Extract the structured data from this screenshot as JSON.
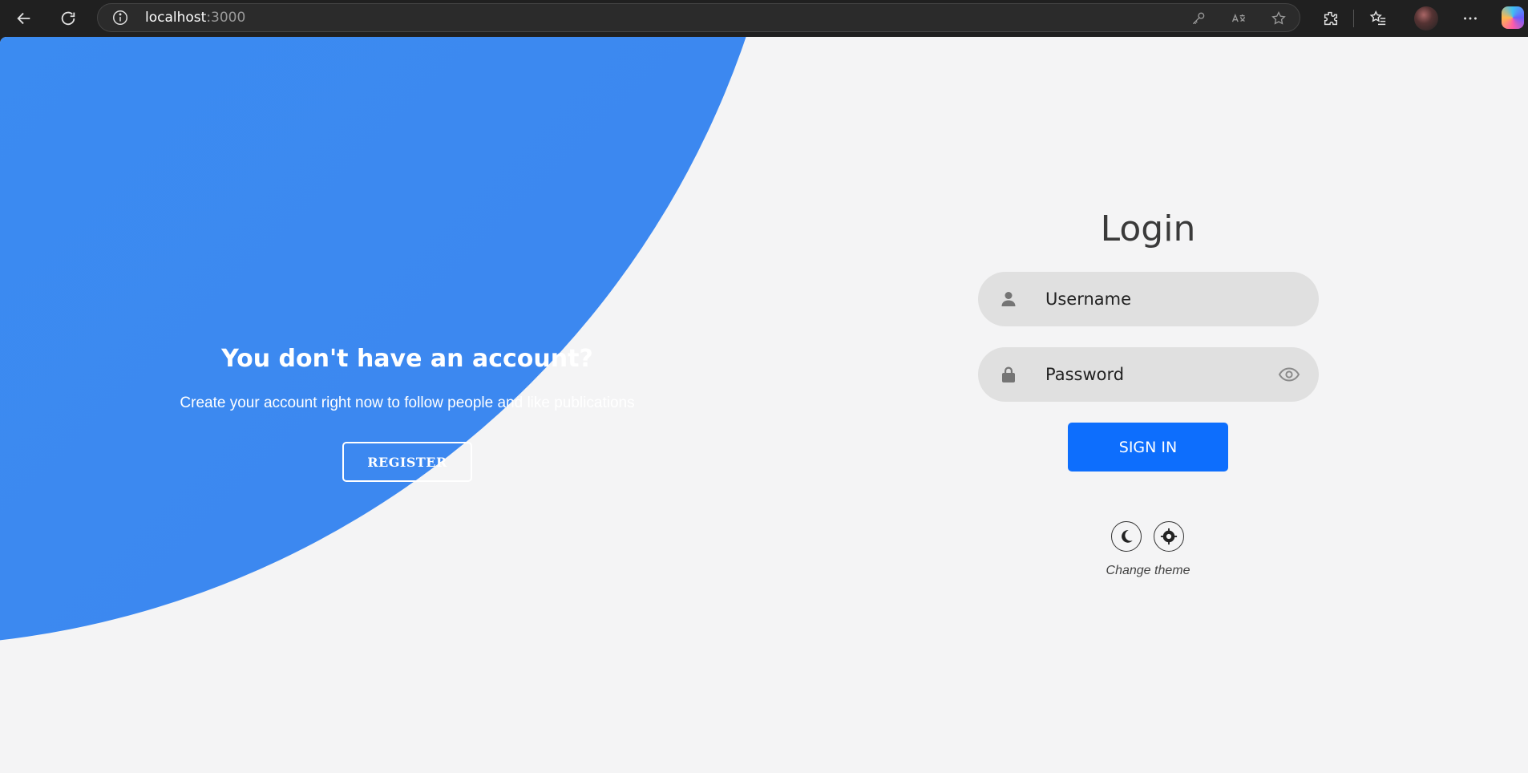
{
  "browser": {
    "url_host": "localhost",
    "url_port": ":3000"
  },
  "promo": {
    "title": "You don't have an account?",
    "text": "Create your account right now to follow people and like publications",
    "register_label": "REGISTER"
  },
  "login": {
    "title": "Login",
    "username_placeholder": "Username",
    "password_placeholder": "Password",
    "signin_label": "SIGN IN",
    "theme_label": "Change theme"
  },
  "colors": {
    "primary_button": "#0d6efd",
    "panel_blue": "#3a8df2",
    "background": "#f4f4f5"
  }
}
